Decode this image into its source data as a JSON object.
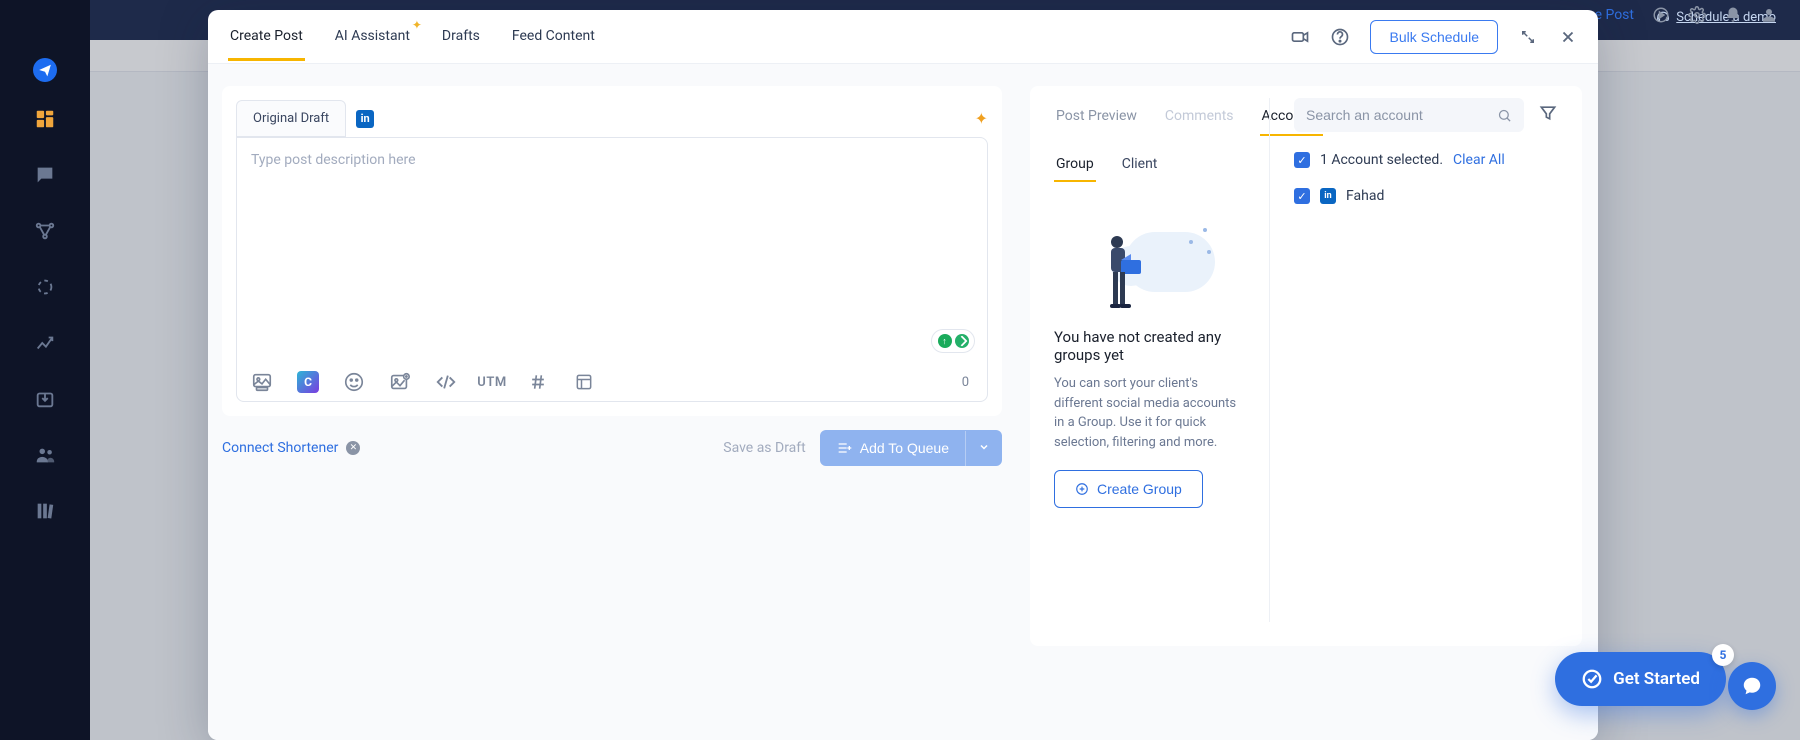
{
  "topbar": {
    "demo": "Schedule a demo",
    "post_fragment": "e Post"
  },
  "modal": {
    "tabs": {
      "create": "Create Post",
      "ai": "AI Assistant",
      "drafts": "Drafts",
      "feed": "Feed Content"
    },
    "bulk": "Bulk Schedule"
  },
  "composer": {
    "draft_tab": "Original Draft",
    "placeholder": "Type post description here",
    "utm": "UTM",
    "char_count": "0",
    "connect_shortener": "Connect Shortener",
    "save_draft": "Save as Draft",
    "add_queue": "Add To Queue"
  },
  "right": {
    "tabs": {
      "preview": "Post Preview",
      "comments": "Comments",
      "accounts": "Accounts"
    },
    "subtabs": {
      "group": "Group",
      "client": "Client"
    },
    "search_placeholder": "Search an account",
    "selected_text": "1 Account selected. ",
    "clear_all": "Clear All",
    "account_name": "Fahad",
    "empty_title": "You have not created any groups yet",
    "empty_desc": "You can sort your client's different social media accounts in a Group. Use it for quick selection, filtering and more.",
    "create_group": "Create Group"
  },
  "get_started": {
    "label": "Get Started",
    "badge": "5"
  }
}
